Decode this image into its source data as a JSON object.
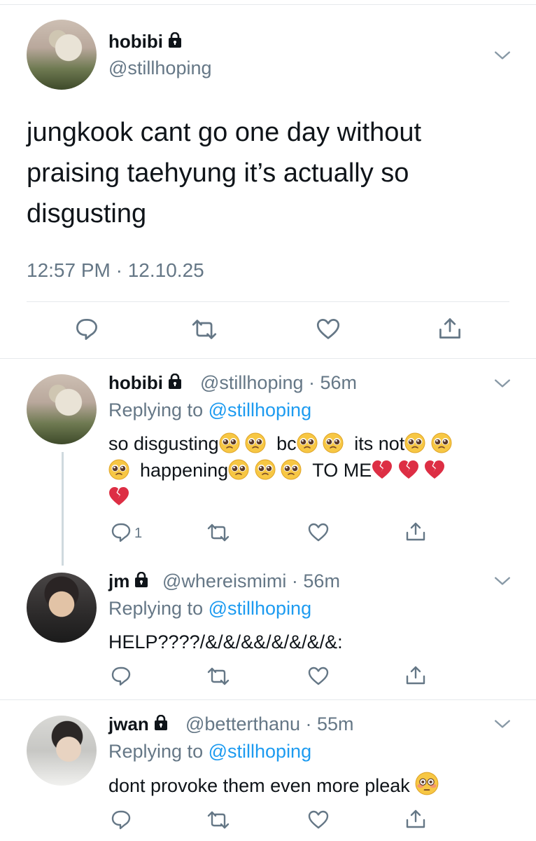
{
  "main_tweet": {
    "name": "hobibi",
    "handle": "@stillhoping",
    "text": "jungkook cant go one day without praising taehyung it’s actually so disgusting",
    "timestamp": "12:57 PM · 12.10.25"
  },
  "replies": [
    {
      "name": "hobibi",
      "handle_time": "@stillhoping · 56m",
      "replying_prefix": "Replying to",
      "replying_to": "@stillhoping",
      "segments": [
        "so disgusting",
        "bc",
        "its not",
        "happening",
        "TO ME"
      ],
      "reply_count": "1"
    },
    {
      "name": "jm",
      "handle_time": "@whereismimi · 56m",
      "replying_prefix": "Replying to",
      "replying_to": "@stillhoping",
      "text": "HELP????/&/&/&&/&/&/&/&:"
    },
    {
      "name": "jwan",
      "handle_time": "@betterthanu · 55m",
      "replying_prefix": "Replying to",
      "replying_to": "@stillhoping",
      "text": "dont provoke them even more pleak"
    }
  ],
  "colors": {
    "link": "#1d9bf0",
    "muted": "#657786",
    "divider": "#e6e9ec",
    "broken_heart": "#dd2e44",
    "emoji_face": "#f7c744"
  },
  "icons": [
    "lock-icon",
    "chevron-down-icon",
    "reply-icon",
    "retweet-icon",
    "like-icon",
    "share-icon",
    "pleading-face-emoji",
    "broken-heart-emoji",
    "flushed-face-emoji"
  ]
}
